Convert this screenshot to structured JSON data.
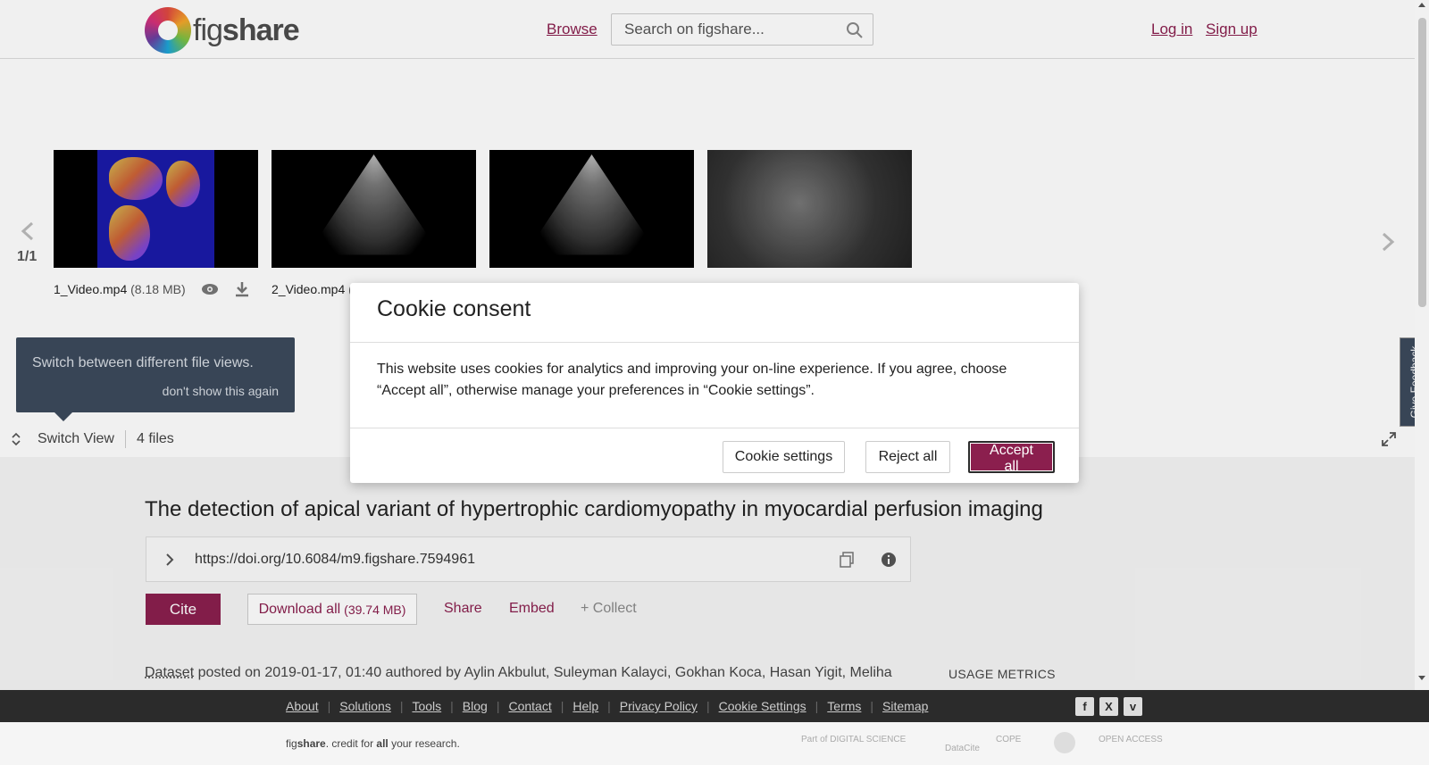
{
  "header": {
    "logo_word_a": "fig",
    "logo_word_b": "share",
    "browse": "Browse",
    "search_placeholder": "Search on figshare...",
    "login": "Log in",
    "signup": "Sign up"
  },
  "gallery": {
    "page_counter": "1/1",
    "files": [
      {
        "name": "1_Video.mp4",
        "size": "(8.18 MB)"
      },
      {
        "name": "2_Video.mp4",
        "size": "("
      }
    ]
  },
  "tooltip": {
    "text": "Switch between different file views.",
    "dismiss": "don't show this again"
  },
  "switch_bar": {
    "label": "Switch View",
    "files_count": "4 files"
  },
  "feedback": "Give Feedback",
  "article": {
    "title": "The detection of apical variant of hypertrophic cardiomyopathy in myocardial perfusion imaging",
    "doi": "https://doi.org/10.6084/m9.figshare.7594961",
    "cite": "Cite",
    "download_all": "Download all",
    "download_size": "(39.74 MB)",
    "share": "Share",
    "embed": "Embed",
    "collect": "+ Collect",
    "item_type": "Dataset",
    "posted_text": " posted on 2019-01-17, 01:40 authored by Aylin Akbulut, Suleyman Kalayci, Gokhan Koca, Hasan Yigit, Meliha",
    "usage_metrics": "USAGE METRICS"
  },
  "footer": {
    "links": [
      "About",
      "Solutions",
      "Tools",
      "Blog",
      "Contact",
      "Help",
      "Privacy Policy",
      "Cookie Settings",
      "Terms",
      "Sitemap"
    ],
    "social": [
      "facebook-icon",
      "x-icon",
      "vimeo-icon"
    ],
    "tagline_a": "fig",
    "tagline_b": "share",
    "tagline_c": ". credit for ",
    "tagline_d": "all",
    "tagline_e": " your research.",
    "partner_digital_science": "Part of DIGITAL SCIENCE",
    "partner_datacite": "DataCite",
    "partner_cope": "COPE",
    "partner_open_access": "OPEN ACCESS"
  },
  "cookie_modal": {
    "title": "Cookie consent",
    "body": "This website uses cookies for analytics and improving your on-line experience. If you agree, choose “Accept all”, otherwise manage your preferences in “Cookie settings”.",
    "settings": "Cookie settings",
    "reject": "Reject all",
    "accept": "Accept all"
  },
  "colors": {
    "brand": "#8b1f4e",
    "tooltip_bg": "#3c4a5c",
    "footer_bg": "#2b2b2b"
  }
}
